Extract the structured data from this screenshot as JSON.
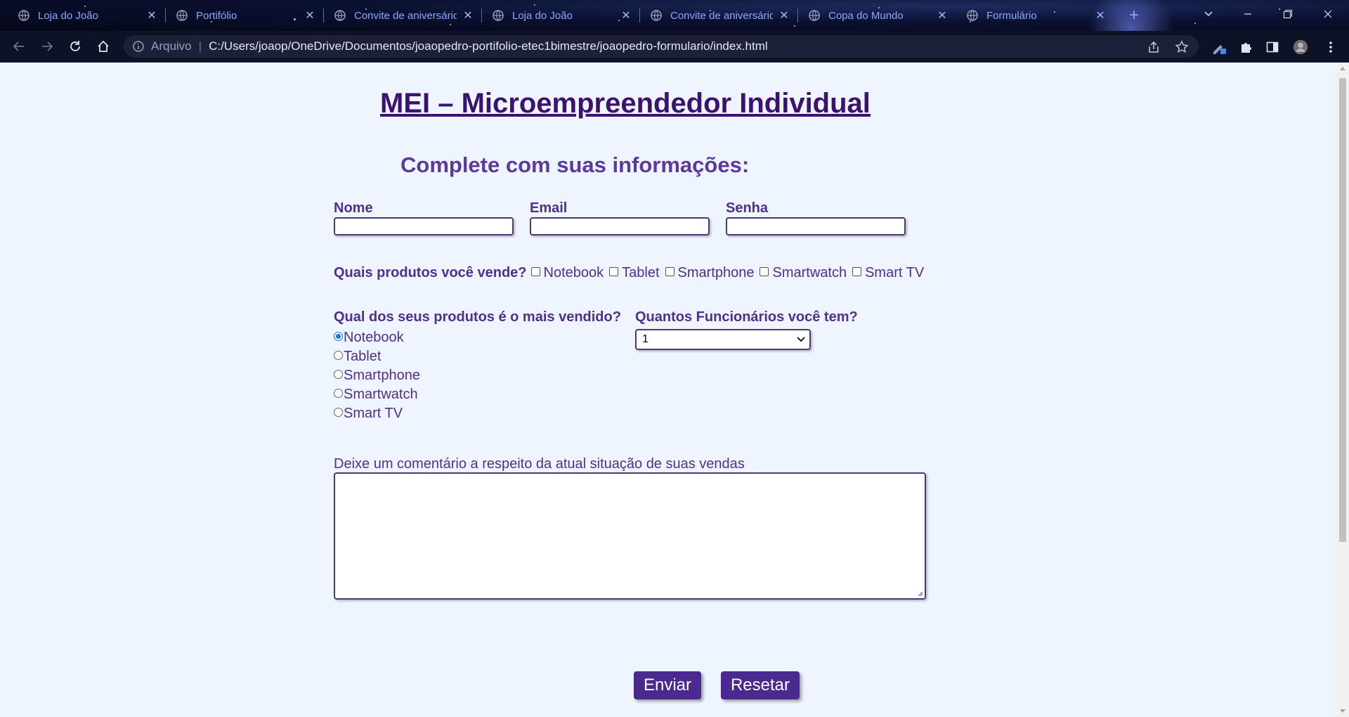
{
  "browser": {
    "tabs": [
      {
        "title": "Loja do João"
      },
      {
        "title": "Portifólio"
      },
      {
        "title": "Convite de aniversário"
      },
      {
        "title": "Loja do João"
      },
      {
        "title": "Convite de aniversário"
      },
      {
        "title": "Copa do Mundo"
      },
      {
        "title": "Formulário"
      }
    ],
    "new_tab_label": "+",
    "address": {
      "scheme_label": "Arquivo",
      "separator": "|",
      "url": "C:/Users/joaop/OneDrive/Documentos/joaopedro-portifolio-etec1bimestre/joaopedro-formulario/index.html"
    }
  },
  "page": {
    "title": "MEI – Microempreendedor Individual",
    "subtitle": "Complete com suas informações:",
    "fields": {
      "name_label": "Nome",
      "name_value": "",
      "email_label": "Email",
      "email_value": "",
      "password_label": "Senha",
      "password_value": ""
    },
    "products": {
      "question": "Quais produtos você vende?",
      "options": [
        "Notebook",
        "Tablet",
        "Smartphone",
        "Smartwatch",
        "Smart TV"
      ],
      "checked": [
        false,
        false,
        false,
        false,
        false
      ]
    },
    "bestseller": {
      "question": "Qual dos seus produtos é o mais vendido?",
      "options": [
        "Notebook",
        "Tablet",
        "Smartphone",
        "Smartwatch",
        "Smart TV"
      ],
      "selected": "Notebook"
    },
    "employees": {
      "question": "Quantos Funcionários você tem?",
      "selected_value": "1"
    },
    "comment": {
      "label": "Deixe um comentário a respeito da atual situação de suas vendas",
      "value": ""
    },
    "buttons": {
      "submit": "Enviar",
      "reset": "Resetar"
    }
  },
  "colors": {
    "title": "#3a1270",
    "label": "#4f2f8f",
    "button_bg": "#4b2a8f",
    "page_bg": "#eef5ff",
    "radio_accent": "#1a73e8"
  }
}
